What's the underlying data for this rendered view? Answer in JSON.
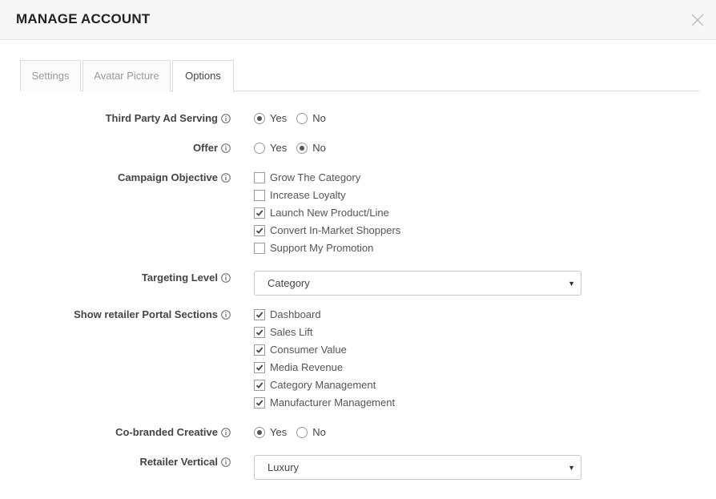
{
  "modal": {
    "title": "MANAGE ACCOUNT"
  },
  "tabs": [
    {
      "label": "Settings",
      "active": false
    },
    {
      "label": "Avatar Picture",
      "active": false
    },
    {
      "label": "Options",
      "active": true
    }
  ],
  "form": {
    "third_party_ad_serving": {
      "label": "Third Party Ad Serving",
      "options": [
        "Yes",
        "No"
      ],
      "selected": "Yes"
    },
    "offer": {
      "label": "Offer",
      "options": [
        "Yes",
        "No"
      ],
      "selected": "No"
    },
    "campaign_objective": {
      "label": "Campaign Objective",
      "items": [
        {
          "label": "Grow The Category",
          "checked": false
        },
        {
          "label": "Increase Loyalty",
          "checked": false
        },
        {
          "label": "Launch New Product/Line",
          "checked": true
        },
        {
          "label": "Convert In-Market Shoppers",
          "checked": true
        },
        {
          "label": "Support My Promotion",
          "checked": false
        }
      ]
    },
    "targeting_level": {
      "label": "Targeting Level",
      "value": "Category"
    },
    "portal_sections": {
      "label": "Show retailer Portal Sections",
      "items": [
        {
          "label": "Dashboard",
          "checked": true
        },
        {
          "label": "Sales Lift",
          "checked": true
        },
        {
          "label": "Consumer Value",
          "checked": true
        },
        {
          "label": "Media Revenue",
          "checked": true
        },
        {
          "label": "Category Management",
          "checked": true
        },
        {
          "label": "Manufacturer Management",
          "checked": true
        }
      ]
    },
    "co_branded_creative": {
      "label": "Co-branded Creative",
      "options": [
        "Yes",
        "No"
      ],
      "selected": "Yes"
    },
    "retailer_vertical": {
      "label": "Retailer Vertical",
      "value": "Luxury"
    }
  },
  "icons": {
    "info": "info-icon",
    "close": "close-icon",
    "dropdown": "caret-down-icon",
    "check": "checkmark-icon"
  }
}
